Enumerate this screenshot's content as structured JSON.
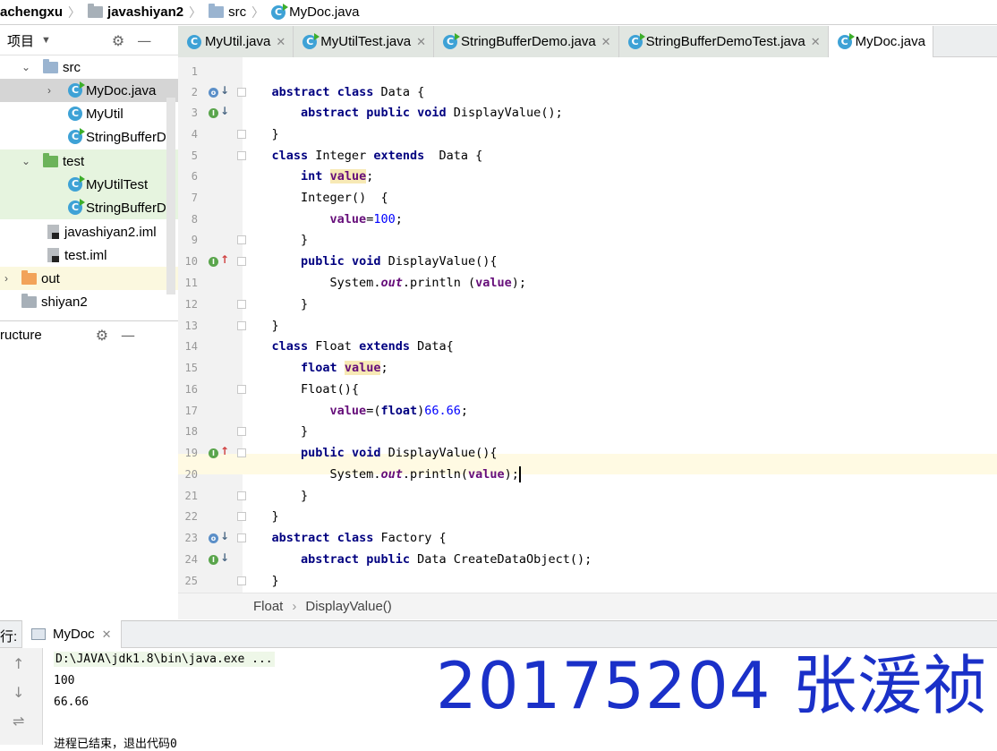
{
  "breadcrumb": {
    "items": [
      {
        "label": "achengxu",
        "icon": "folder-icon"
      },
      {
        "label": "javashiyan2",
        "icon": "module-icon"
      },
      {
        "label": "src",
        "icon": "folder-icon"
      },
      {
        "label": "MyDoc.java",
        "icon": "java-class-icon"
      }
    ]
  },
  "project_panel": {
    "title": "项目",
    "tree": [
      {
        "label": "src",
        "type": "folder"
      },
      {
        "label": "MyDoc.java",
        "type": "class-run"
      },
      {
        "label": "MyUtil",
        "type": "class"
      },
      {
        "label": "StringBufferDe",
        "type": "class-run"
      },
      {
        "label": "test",
        "type": "folder"
      },
      {
        "label": "MyUtilTest",
        "type": "class-run"
      },
      {
        "label": "StringBufferDe",
        "type": "class-run"
      },
      {
        "label": "javashiyan2.iml",
        "type": "file"
      },
      {
        "label": "test.iml",
        "type": "file"
      },
      {
        "label": "out",
        "type": "folder-orange"
      },
      {
        "label": "shiyan2",
        "type": "folder-gray"
      }
    ]
  },
  "structure_panel": {
    "title": "ructure"
  },
  "tabs": [
    {
      "label": "MyUtil.java"
    },
    {
      "label": "MyUtilTest.java"
    },
    {
      "label": "StringBufferDemo.java"
    },
    {
      "label": "StringBufferDemoTest.java"
    },
    {
      "label": "MyDoc.java"
    }
  ],
  "editor": {
    "line_numbers": [
      "1",
      "2",
      "3",
      "4",
      "5",
      "6",
      "7",
      "8",
      "9",
      "10",
      "11",
      "12",
      "13",
      "14",
      "15",
      "16",
      "17",
      "18",
      "19",
      "20",
      "21",
      "22",
      "23",
      "24",
      "25"
    ],
    "current_line": "20"
  },
  "code_tokens": {
    "abstract": "abstract",
    "class": "class",
    "public": "public",
    "void": "void",
    "extends": "extends",
    "int": "int",
    "float": "float",
    "Data": "Data",
    "DisplayValue": "DisplayValue",
    "Integer": "Integer",
    "Float": "Float",
    "Factory": "Factory",
    "CreateDataObject": "CreateDataObject",
    "value": "value",
    "System": "System.",
    "out": "out",
    "println": ".println",
    "n100": "100",
    "n6666": "66.66"
  },
  "code_crumbs": {
    "item1": "Float",
    "item2": "DisplayValue()"
  },
  "run_panel": {
    "label": "行:",
    "tab": "MyDoc",
    "lines": [
      "D:\\JAVA\\jdk1.8\\bin\\java.exe ...",
      "100",
      "66.66",
      "进程已结束，退出代码0"
    ]
  },
  "watermark": "20175204  张湲祯"
}
